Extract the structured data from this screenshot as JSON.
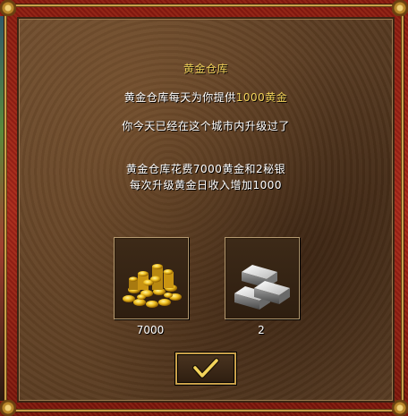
{
  "dialog": {
    "title": "黄金仓库",
    "info_prefix": "黄金仓库每天为你提供",
    "info_amount": "1000黄金",
    "status": "你今天已经在这个城市内升级过了",
    "cost_line": "黄金仓库花费7000黄金和2秘银",
    "income_line": "每次升级黄金日收入增加1000"
  },
  "resources": [
    {
      "name": "gold",
      "icon": "gold-coins-icon",
      "amount": "7000"
    },
    {
      "name": "mithril",
      "icon": "silver-bars-icon",
      "amount": "2"
    }
  ],
  "buttons": {
    "ok_icon": "checkmark-icon"
  },
  "colors": {
    "highlight_text": "#f2d35a",
    "text": "#ffffff",
    "frame_red": "#a8261a",
    "frame_gold": "#c9a04a"
  }
}
